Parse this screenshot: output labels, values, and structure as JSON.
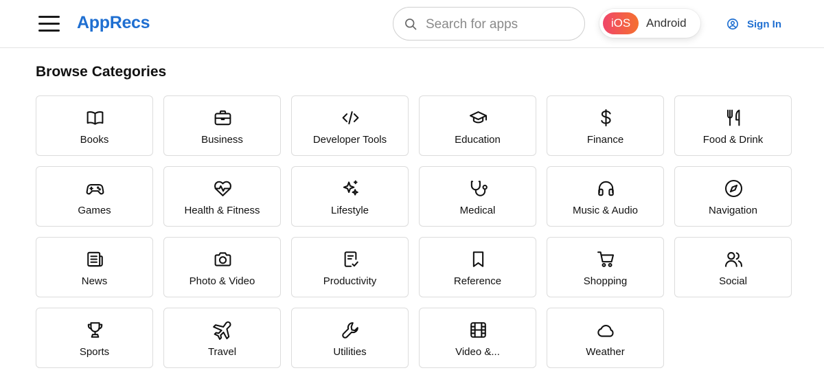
{
  "header": {
    "logo_text": "AppRecs",
    "search_placeholder": "Search for apps",
    "search_value": "",
    "platform": {
      "ios_label": "iOS",
      "android_label": "Android",
      "selected": "iOS"
    },
    "signin_label": "Sign In"
  },
  "colors": {
    "brand": "#1f6fd1",
    "ios_gradient_start": "#f0466a",
    "ios_gradient_end": "#f5702f"
  },
  "page": {
    "title": "Browse Categories"
  },
  "categories": [
    {
      "label": "Books",
      "icon": "book-open-icon"
    },
    {
      "label": "Business",
      "icon": "briefcase-icon"
    },
    {
      "label": "Developer Tools",
      "icon": "code-icon"
    },
    {
      "label": "Education",
      "icon": "graduation-cap-icon"
    },
    {
      "label": "Finance",
      "icon": "dollar-sign-icon"
    },
    {
      "label": "Food & Drink",
      "icon": "fork-knife-icon"
    },
    {
      "label": "Games",
      "icon": "gamepad-icon"
    },
    {
      "label": "Health & Fitness",
      "icon": "heart-pulse-icon"
    },
    {
      "label": "Lifestyle",
      "icon": "sparkles-icon"
    },
    {
      "label": "Medical",
      "icon": "stethoscope-icon"
    },
    {
      "label": "Music & Audio",
      "icon": "headphones-icon"
    },
    {
      "label": "Navigation",
      "icon": "compass-icon"
    },
    {
      "label": "News",
      "icon": "newspaper-icon"
    },
    {
      "label": "Photo & Video",
      "icon": "camera-icon"
    },
    {
      "label": "Productivity",
      "icon": "clipboard-check-icon"
    },
    {
      "label": "Reference",
      "icon": "bookmark-icon"
    },
    {
      "label": "Shopping",
      "icon": "shopping-cart-icon"
    },
    {
      "label": "Social",
      "icon": "users-icon"
    },
    {
      "label": "Sports",
      "icon": "trophy-icon"
    },
    {
      "label": "Travel",
      "icon": "plane-icon"
    },
    {
      "label": "Utilities",
      "icon": "wrench-icon"
    },
    {
      "label": "Video &...",
      "icon": "film-icon"
    },
    {
      "label": "Weather",
      "icon": "cloud-icon"
    }
  ]
}
